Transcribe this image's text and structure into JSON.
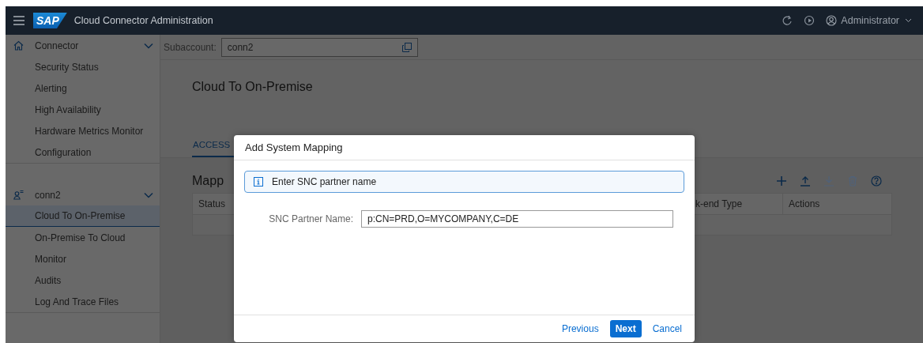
{
  "shell": {
    "logo": "SAP",
    "title": "Cloud Connector Administration",
    "user": "Administrator"
  },
  "sidebar": {
    "sections": [
      {
        "label": "Connector",
        "kind": "home",
        "expanded": true,
        "items": [
          {
            "label": "Security Status",
            "selected": false
          },
          {
            "label": "Alerting",
            "selected": false
          },
          {
            "label": "High Availability",
            "selected": false
          },
          {
            "label": "Hardware Metrics Monitor",
            "selected": false
          },
          {
            "label": "Configuration",
            "selected": false
          }
        ]
      },
      {
        "label": "conn2",
        "kind": "account",
        "expanded": true,
        "items": [
          {
            "label": "Cloud To On-Premise",
            "selected": true
          },
          {
            "label": "On-Premise To Cloud",
            "selected": false
          },
          {
            "label": "Monitor",
            "selected": false
          },
          {
            "label": "Audits",
            "selected": false
          },
          {
            "label": "Log And Trace Files",
            "selected": false
          }
        ]
      }
    ]
  },
  "subaccount": {
    "label": "Subaccount:",
    "value": "conn2"
  },
  "page": {
    "title": "Cloud To On-Premise",
    "tabs": [
      {
        "label": "ACCESS",
        "selected": true
      }
    ],
    "panel": {
      "title": "Mapp",
      "toolbar": [
        {
          "kind": "add",
          "disabled": false
        },
        {
          "kind": "upload",
          "disabled": false
        },
        {
          "kind": "download",
          "disabled": true
        },
        {
          "kind": "delete",
          "disabled": true
        },
        {
          "kind": "help",
          "disabled": false
        }
      ],
      "columns": [
        "Status",
        "k-end Type",
        "Actions"
      ]
    }
  },
  "dialog": {
    "title": "Add System Mapping",
    "message": "Enter SNC partner name",
    "field": {
      "label": "SNC Partner Name:",
      "value": "p:CN=PRD,O=MYCOMPANY,C=DE"
    },
    "buttons": [
      {
        "label": "Previous",
        "kind": "transparent"
      },
      {
        "label": "Next",
        "kind": "emphasized"
      },
      {
        "label": "Cancel",
        "kind": "transparent"
      }
    ]
  }
}
